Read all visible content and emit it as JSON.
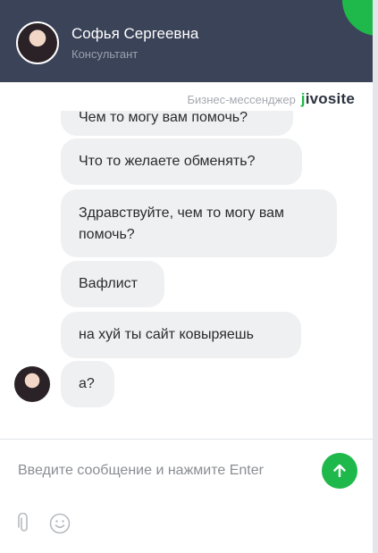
{
  "operator": {
    "name": "Софья Сергеевна",
    "role": "Консультант"
  },
  "branding": {
    "caption": "Бизнес-мессенджер",
    "logo_prefix": "j",
    "logo_rest": "ivosite"
  },
  "messages": [
    {
      "text": "Чем то могу вам помочь?"
    },
    {
      "text": "Что то желаете обменять?"
    },
    {
      "line1": "Здравствуйте, чем то могу вам",
      "line2": "помочь?"
    },
    {
      "text": "Вафлист"
    },
    {
      "text": "на хуй ты сайт ковыряешь"
    },
    {
      "text": "а?"
    }
  ],
  "composer": {
    "placeholder": "Введите сообщение и нажмите Enter"
  },
  "icons": {
    "send": "arrow-up-icon",
    "attach": "paperclip-icon",
    "emoji": "smile-icon"
  },
  "colors": {
    "header": "#3b4358",
    "accent": "#1fb84a",
    "bubble": "#eff0f2"
  }
}
